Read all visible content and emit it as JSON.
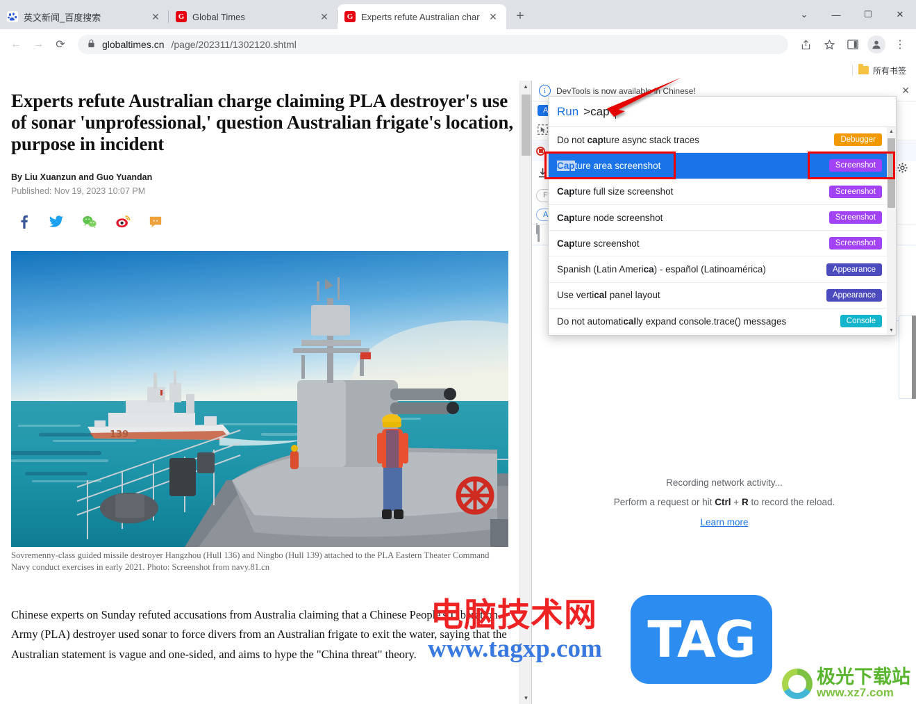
{
  "browser": {
    "tabs": [
      {
        "title": "英文新闻_百度搜索",
        "favicon": "baidu-icon",
        "active": false
      },
      {
        "title": "Global Times",
        "favicon": "globaltimes-icon",
        "active": false
      },
      {
        "title": "Experts refute Australian char",
        "favicon": "globaltimes-icon",
        "active": true
      }
    ],
    "new_tab_label": "+",
    "window_controls": {
      "minimize_more": "⌄",
      "minimize": "—",
      "maximize": "☐",
      "close": "✕"
    },
    "nav": {
      "back": "←",
      "forward": "→",
      "reload": "⟳"
    },
    "url": {
      "lock": "🔒",
      "host": "globaltimes.cn",
      "path": "/page/202311/1302120.shtml"
    },
    "toolbar_icons": {
      "share": "share-icon",
      "bookmark": "star-icon",
      "sidepanel": "sidepanel-icon",
      "profile": "profile-icon",
      "menu": "kebab-menu-icon"
    },
    "bookmarks": {
      "all_bookmarks_label": "所有书签"
    }
  },
  "article": {
    "headline": "Experts refute Australian charge claiming PLA destroyer's use of sonar 'unprofessional,' question Australian frigate's location, purpose in incident",
    "byline": "By Liu Xuanzun and Guo Yuandan",
    "published": "Published: Nov 19, 2023 10:07 PM",
    "share_icons": [
      "facebook-icon",
      "twitter-icon",
      "wechat-icon",
      "weibo-icon",
      "comment-icon"
    ],
    "photo_caption": "Sovremenny-class guided missile destroyer Hangzhou (Hull 136) and Ningbo (Hull 139) attached to the PLA Eastern Theater Command Navy conduct exercises in early 2021. Photo: Screenshot from navy.81.cn",
    "body_paragraph": "Chinese experts on Sunday refuted accusations from Australia claiming that a Chinese People's Liberation Army (PLA) destroyer used sonar to force divers from an Australian frigate to exit the water, saying that the Australian statement is vague and one-sided, and aims to hype the \"China threat\" theory.",
    "photo_hull_numbers": "139"
  },
  "devtools": {
    "banner_text": "DevTools is now available in Chinese!",
    "banner_close": "✕",
    "chip_label": "All",
    "filter_placeholder": "Filter",
    "pill_all": "All",
    "close_icon": "close-icon",
    "gear_icon": "gear-icon",
    "inspect_icon": "inspect-element-icon",
    "record_icon": "record-icon",
    "import_icon": "import-har-icon",
    "empty_state": {
      "line1": "Recording network activity...",
      "line2_pre": "Perform a request or hit ",
      "line2_key1": "Ctrl",
      "line2_plus": " + ",
      "line2_key2": "R",
      "line2_post": " to record the reload.",
      "learn_more": "Learn more"
    }
  },
  "palette": {
    "prefix": "Run",
    "query": ">cap",
    "items": [
      {
        "pre": "Do not ",
        "hl": "cap",
        "post": "ture async stack traces",
        "badge": "Debugger",
        "badge_color": "#f29900",
        "selected": false
      },
      {
        "pre": "",
        "hl": "Cap",
        "post": "ture area screenshot",
        "badge": "Screenshot",
        "badge_color": "#a142f4",
        "selected": true
      },
      {
        "pre": "",
        "hl": "Cap",
        "post": "ture full size screenshot",
        "badge": "Screenshot",
        "badge_color": "#a142f4",
        "selected": false
      },
      {
        "pre": "",
        "hl": "Cap",
        "post": "ture node screenshot",
        "badge": "Screenshot",
        "badge_color": "#a142f4",
        "selected": false
      },
      {
        "pre": "",
        "hl": "Cap",
        "post": "ture screenshot",
        "badge": "Screenshot",
        "badge_color": "#a142f4",
        "selected": false
      },
      {
        "pre": "Spanish (Latin Ameri",
        "hl": "ca",
        "post": ") - español (Latinoamérica)",
        "badge": "Appearance",
        "badge_color": "#4b4bbd",
        "selected": false
      },
      {
        "pre": "Use verti",
        "hl": "cal",
        "post": " panel layout",
        "badge": "Appearance",
        "badge_color": "#4b4bbd",
        "selected": false
      },
      {
        "pre": "Do not automati",
        "hl": "cal",
        "post": "ly expand console.trace() messages",
        "badge": "Console",
        "badge_color": "#12b5cb",
        "selected": false
      }
    ],
    "scroll_up": "▲",
    "scroll_down": "▼"
  },
  "annotations": {
    "arrow_color": "#ee0000",
    "box_color": "#ee0000",
    "arrow_name": "red-pointer-arrow"
  },
  "watermarks": {
    "cn_text": "电脑技术网",
    "url_text": "www.tagxp.com",
    "tag_text": "TAG",
    "xz7_cn": "极光下载站",
    "xz7_url": "www.xz7.com"
  }
}
